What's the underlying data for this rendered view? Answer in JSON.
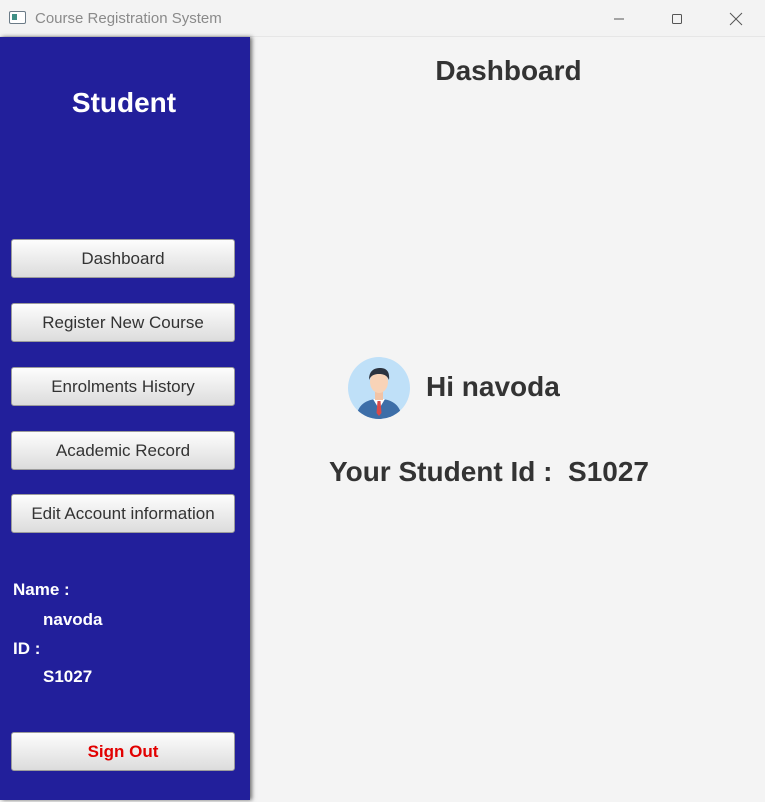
{
  "window": {
    "title": "Course Registration System"
  },
  "sidebar": {
    "title": "Student",
    "buttons": [
      {
        "label": "Dashboard"
      },
      {
        "label": "Register New Course"
      },
      {
        "label": "Enrolments History"
      },
      {
        "label": "Academic Record"
      },
      {
        "label": "Edit Account information"
      }
    ],
    "info": {
      "name_label": "Name :",
      "name_value": "navoda",
      "id_label": "ID :",
      "id_value": "S1027"
    },
    "signout_label": "Sign Out"
  },
  "main": {
    "title": "Dashboard",
    "greeting_prefix": "Hi",
    "greeting_name": "navoda",
    "student_id_label": "Your Student Id :",
    "student_id_value": "S1027"
  },
  "colors": {
    "sidebar_bg": "#221f9b",
    "signout_text": "#e20000",
    "main_bg": "#f4f4f4"
  },
  "icons": {
    "app": "app-window-icon",
    "avatar": "user-avatar-icon"
  }
}
